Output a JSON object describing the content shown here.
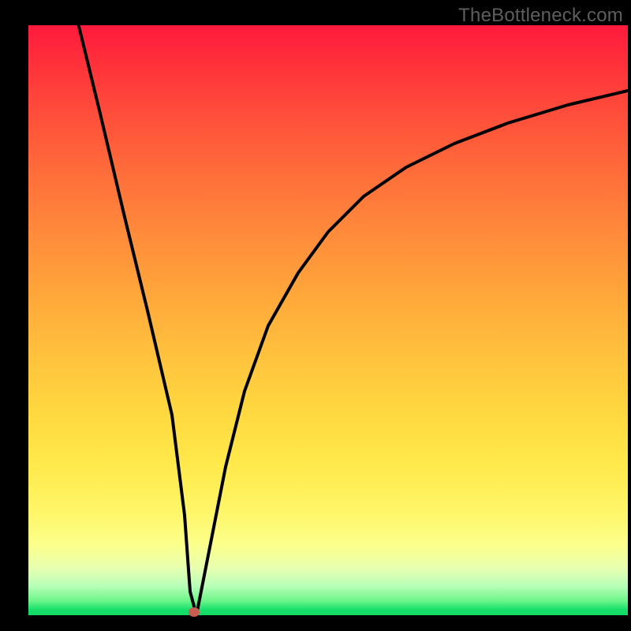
{
  "watermark": "TheBottleneck.com",
  "chart_data": {
    "type": "line",
    "title": "",
    "xlabel": "",
    "ylabel": "",
    "xlim": [
      0,
      100
    ],
    "ylim": [
      0,
      100
    ],
    "grid": false,
    "legend": false,
    "series": [
      {
        "name": "curve",
        "x": [
          8,
          12,
          16,
          20,
          24,
          26,
          27,
          28,
          30,
          33,
          36,
          40,
          45,
          50,
          56,
          63,
          71,
          80,
          90,
          100
        ],
        "y": [
          102,
          85,
          68,
          51,
          34,
          17,
          4,
          0,
          10,
          25,
          38,
          49,
          58,
          65,
          71,
          76,
          80,
          83.5,
          86.5,
          89
        ]
      }
    ],
    "marker": {
      "x": 27.5,
      "y": 0
    },
    "colors": {
      "curve": "#000000",
      "marker": "#c95c53",
      "gradient_top": "#ff1a3d",
      "gradient_mid": "#ffd93f",
      "gradient_bottom": "#12d765",
      "frame": "#000000"
    }
  }
}
